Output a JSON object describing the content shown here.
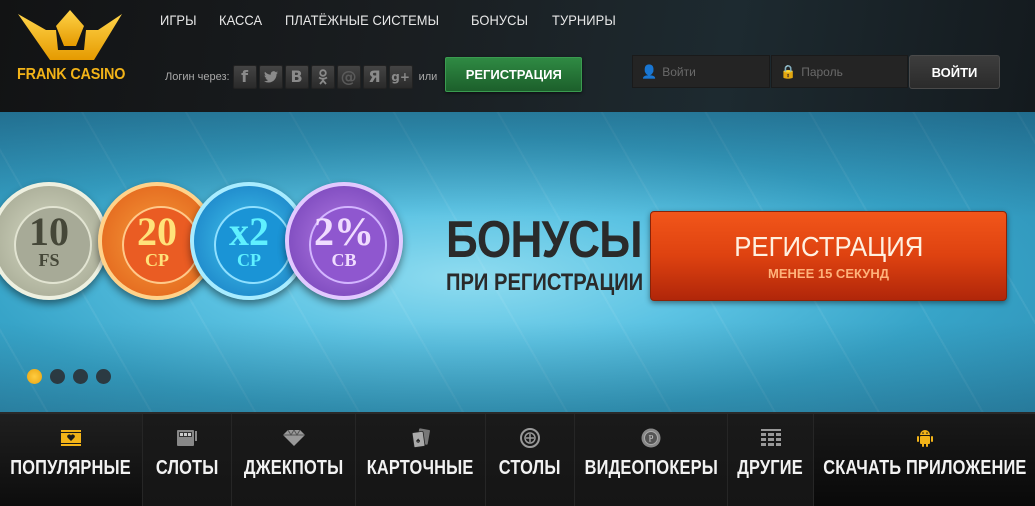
{
  "brand": {
    "name": "FRANK CASINO",
    "accent_gold": "#f2b318"
  },
  "topnav": [
    {
      "label": "ИГРЫ"
    },
    {
      "label": "КАССА"
    },
    {
      "label": "ПЛАТЁЖНЫЕ СИСТЕМЫ"
    },
    {
      "label": "БОНУСЫ"
    },
    {
      "label": "ТУРНИРЫ"
    }
  ],
  "social_login": {
    "label": "Логин через:",
    "or_label": "или",
    "icons": [
      {
        "name": "facebook-icon",
        "glyph": "f"
      },
      {
        "name": "twitter-icon",
        "glyph": "🐦"
      },
      {
        "name": "vkontakte-icon",
        "glyph": "B"
      },
      {
        "name": "odnoklassniki-icon",
        "glyph": "ʘ"
      },
      {
        "name": "mailru-icon",
        "glyph": "@"
      },
      {
        "name": "yandex-icon",
        "glyph": "Я"
      },
      {
        "name": "google-plus-icon",
        "glyph": "g+"
      }
    ],
    "register_label": "РЕГИСТРАЦИЯ",
    "register_color": "#2f8a43"
  },
  "login": {
    "username_placeholder": "Войти",
    "password_placeholder": "Пароль",
    "submit_label": "ВОЙТИ"
  },
  "banner": {
    "chips": [
      {
        "value": "10",
        "sub": "FS",
        "color": "gray"
      },
      {
        "value": "20",
        "sub": "CP",
        "color": "orange"
      },
      {
        "value": "x2",
        "sub": "CP",
        "color": "blue"
      },
      {
        "value": "2%",
        "sub": "CB",
        "color": "purple"
      }
    ],
    "title": "БОНУСЫ",
    "subtitle": "ПРИ РЕГИСТРАЦИИ",
    "cta_label": "РЕГИСТРАЦИЯ",
    "cta_note": "МЕНЕЕ 15 СЕКУНД",
    "cta_color": "#de4210",
    "slides_total": 4,
    "slide_active": 1
  },
  "categories": [
    {
      "label": "ПОПУЛЯРНЫЕ",
      "icon": "popular-icon",
      "glyph": "♥",
      "active": true
    },
    {
      "label": "СЛОТЫ",
      "icon": "slot-machine-icon",
      "glyph": "🎰"
    },
    {
      "label": "ДЖЕКПОТЫ",
      "icon": "diamond-icon",
      "glyph": "💎"
    },
    {
      "label": "КАРТОЧНЫЕ",
      "icon": "cards-icon",
      "glyph": "🂡"
    },
    {
      "label": "СТОЛЫ",
      "icon": "roulette-icon",
      "glyph": "⊕"
    },
    {
      "label": "ВИДЕОПОКЕРЫ",
      "icon": "poker-chip-icon",
      "glyph": "Ⓟ"
    },
    {
      "label": "ДРУГИЕ",
      "icon": "grid-icon",
      "glyph": "▦"
    },
    {
      "label": "СКАЧАТЬ ПРИЛОЖЕНИЕ",
      "icon": "android-icon",
      "glyph": "🤖"
    }
  ]
}
